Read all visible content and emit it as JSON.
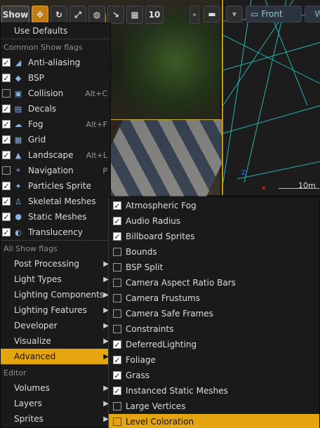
{
  "toolbar": {
    "show_label": "Show",
    "zoom_value": "10",
    "right": {
      "view_label": "Front",
      "wi_label": "Wi"
    }
  },
  "viewport_right": {
    "scale_label": "10m"
  },
  "main_menu": {
    "use_defaults": "Use Defaults",
    "common_header": "Common Show flags",
    "common_items": [
      {
        "label": "Anti-aliasing",
        "checked": true,
        "shortcut": "",
        "icon": "anti-aliasing-icon"
      },
      {
        "label": "BSP",
        "checked": true,
        "shortcut": "",
        "icon": "bsp-icon"
      },
      {
        "label": "Collision",
        "checked": false,
        "shortcut": "Alt+C",
        "icon": "collision-icon"
      },
      {
        "label": "Decals",
        "checked": true,
        "shortcut": "",
        "icon": "decals-icon"
      },
      {
        "label": "Fog",
        "checked": true,
        "shortcut": "Alt+F",
        "icon": "fog-icon"
      },
      {
        "label": "Grid",
        "checked": true,
        "shortcut": "",
        "icon": "grid-icon"
      },
      {
        "label": "Landscape",
        "checked": true,
        "shortcut": "Alt+L",
        "icon": "landscape-icon"
      },
      {
        "label": "Navigation",
        "checked": false,
        "shortcut": "P",
        "icon": "navigation-icon"
      },
      {
        "label": "Particles Sprite",
        "checked": true,
        "shortcut": "",
        "icon": "particles-icon"
      },
      {
        "label": "Skeletal Meshes",
        "checked": true,
        "shortcut": "",
        "icon": "skeletal-icon"
      },
      {
        "label": "Static Meshes",
        "checked": true,
        "shortcut": "",
        "icon": "static-mesh-icon"
      },
      {
        "label": "Translucency",
        "checked": true,
        "shortcut": "",
        "icon": "translucency-icon"
      }
    ],
    "all_header": "All Show flags",
    "all_items": [
      {
        "label": "Post Processing",
        "selected": false
      },
      {
        "label": "Light Types",
        "selected": false
      },
      {
        "label": "Lighting Components",
        "selected": false
      },
      {
        "label": "Lighting Features",
        "selected": false
      },
      {
        "label": "Developer",
        "selected": false
      },
      {
        "label": "Visualize",
        "selected": false
      },
      {
        "label": "Advanced",
        "selected": true
      }
    ],
    "editor_header": "Editor",
    "editor_items": [
      {
        "label": "Volumes"
      },
      {
        "label": "Layers"
      },
      {
        "label": "Sprites"
      }
    ]
  },
  "sub_menu": {
    "items": [
      {
        "label": "Atmospheric Fog",
        "checked": true,
        "selected": false
      },
      {
        "label": "Audio Radius",
        "checked": true,
        "selected": false
      },
      {
        "label": "Billboard Sprites",
        "checked": true,
        "selected": false
      },
      {
        "label": "Bounds",
        "checked": false,
        "selected": false
      },
      {
        "label": "BSP Split",
        "checked": false,
        "selected": false
      },
      {
        "label": "Camera Aspect Ratio Bars",
        "checked": false,
        "selected": false
      },
      {
        "label": "Camera Frustums",
        "checked": false,
        "selected": false
      },
      {
        "label": "Camera Safe Frames",
        "checked": false,
        "selected": false
      },
      {
        "label": "Constraints",
        "checked": false,
        "selected": false
      },
      {
        "label": "DeferredLighting",
        "checked": true,
        "selected": false
      },
      {
        "label": "Foliage",
        "checked": true,
        "selected": false
      },
      {
        "label": "Grass",
        "checked": true,
        "selected": false
      },
      {
        "label": "Instanced Static Meshes",
        "checked": true,
        "selected": false
      },
      {
        "label": "Large Vertices",
        "checked": false,
        "selected": false
      },
      {
        "label": "Level Coloration",
        "checked": false,
        "selected": true
      }
    ]
  },
  "colors": {
    "accent": "#e5a511",
    "menu_bg": "#1a1a1a",
    "wire": "#1fb6b0"
  }
}
